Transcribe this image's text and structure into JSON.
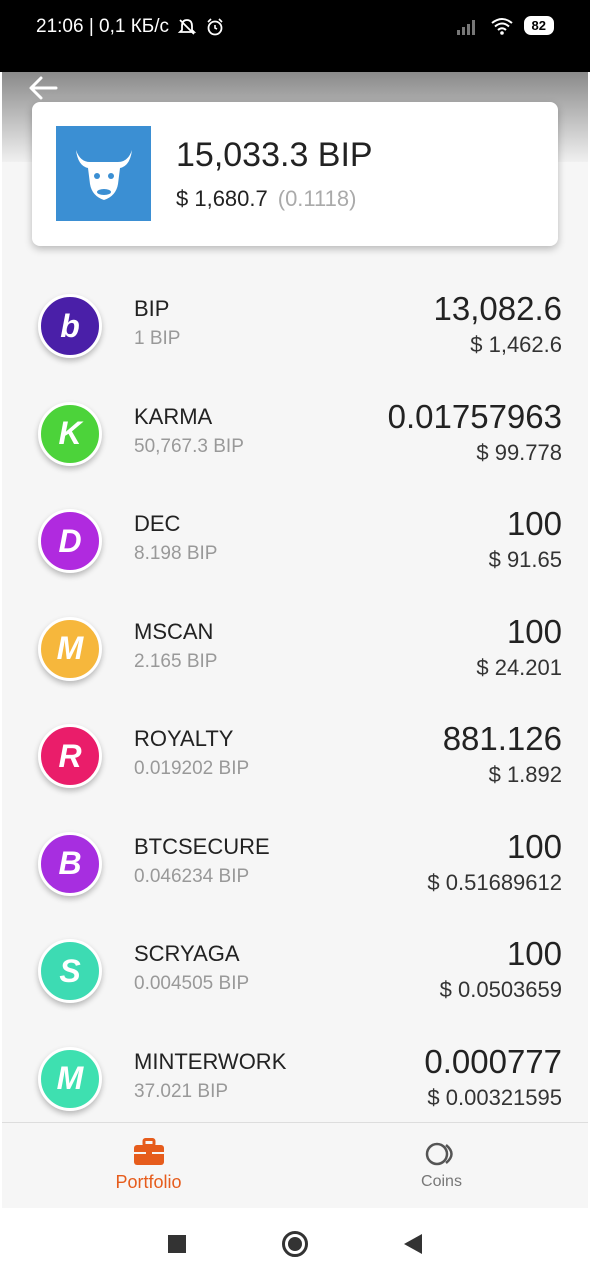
{
  "status_bar": {
    "time_and_speed": "21:06 | 0,1 КБ/с",
    "battery": "82"
  },
  "portfolio": {
    "total_bip": "15,033.3 BIP",
    "total_usd": "$ 1,680.7",
    "rate": "(0.1118)"
  },
  "coins": [
    {
      "letter": "b",
      "color": "#4a1fa8",
      "name": "BIP",
      "bip": "1 BIP",
      "amount": "13,082.6",
      "usd": "$ 1,462.6"
    },
    {
      "letter": "K",
      "color": "#4cd33a",
      "name": "KARMA",
      "bip": "50,767.3 BIP",
      "amount": "0.01757963",
      "usd": "$ 99.778"
    },
    {
      "letter": "D",
      "color": "#b02adf",
      "name": "DEC",
      "bip": "8.198 BIP",
      "amount": "100",
      "usd": "$ 91.65"
    },
    {
      "letter": "M",
      "color": "#f6b73c",
      "name": "MSCAN",
      "bip": "2.165 BIP",
      "amount": "100",
      "usd": "$ 24.201"
    },
    {
      "letter": "R",
      "color": "#ea1d6a",
      "name": "ROYALTY",
      "bip": "0.019202 BIP",
      "amount": "881.126",
      "usd": "$ 1.892"
    },
    {
      "letter": "B",
      "color": "#a72ee0",
      "name": "BTCSECURE",
      "bip": "0.046234 BIP",
      "amount": "100",
      "usd": "$ 0.51689612"
    },
    {
      "letter": "S",
      "color": "#3ddbb3",
      "name": "SCRYAGA",
      "bip": "0.004505 BIP",
      "amount": "100",
      "usd": "$ 0.0503659"
    },
    {
      "letter": "M",
      "color": "#3ee0b0",
      "name": "MINTERWORK",
      "bip": "37.021 BIP",
      "amount": "0.000777",
      "usd": "$ 0.00321595"
    }
  ],
  "bottom_nav": {
    "portfolio": "Portfolio",
    "coins": "Coins"
  },
  "colors": {
    "accent": "#e65c1c",
    "logo_bg": "#3b8fd3"
  }
}
